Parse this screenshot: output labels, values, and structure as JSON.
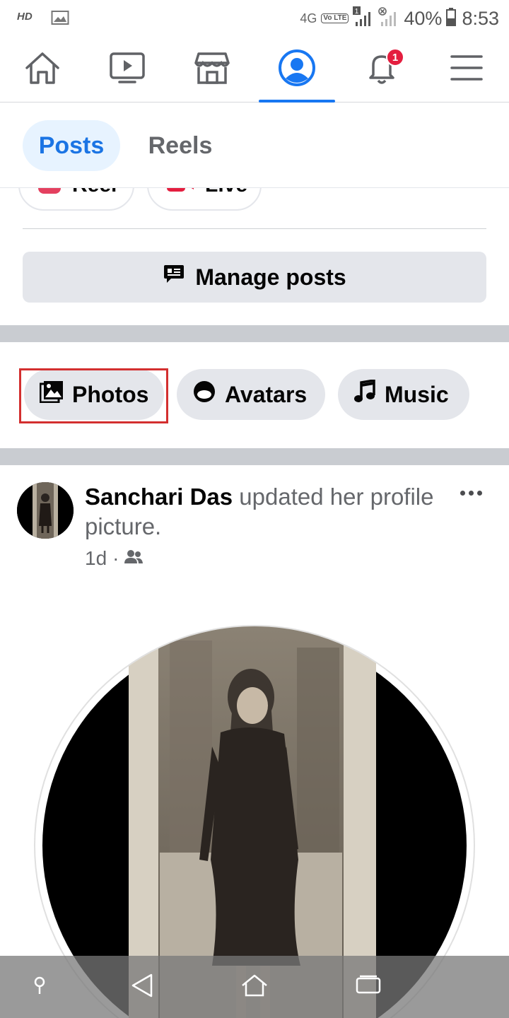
{
  "status_bar": {
    "hd": "HD",
    "network": "4G",
    "volte": "Vo LTE",
    "sim_badge": "1",
    "battery": "40%",
    "time": "8:53"
  },
  "top_nav": {
    "items": [
      "home-icon",
      "watch-icon",
      "marketplace-icon",
      "profile-icon",
      "notifications-icon",
      "menu-icon"
    ],
    "active": "profile-icon",
    "notification_count": "1",
    "accent_color": "#1877f2"
  },
  "tabs": [
    {
      "label": "Posts",
      "active": true
    },
    {
      "label": "Reels",
      "active": false
    }
  ],
  "partial_chips": [
    {
      "label": "Reel"
    },
    {
      "label": "Live"
    }
  ],
  "manage_posts": {
    "label": "Manage posts"
  },
  "categories": [
    {
      "label": "Photos",
      "icon": "photos-icon",
      "highlighted": true
    },
    {
      "label": "Avatars",
      "icon": "avatar-icon",
      "highlighted": false
    },
    {
      "label": "Music",
      "icon": "music-note-icon",
      "highlighted": false
    }
  ],
  "post": {
    "author": "Sanchari Das",
    "action": " updated her profile picture.",
    "time": "1d",
    "separator": "·",
    "audience": "friends-icon"
  }
}
